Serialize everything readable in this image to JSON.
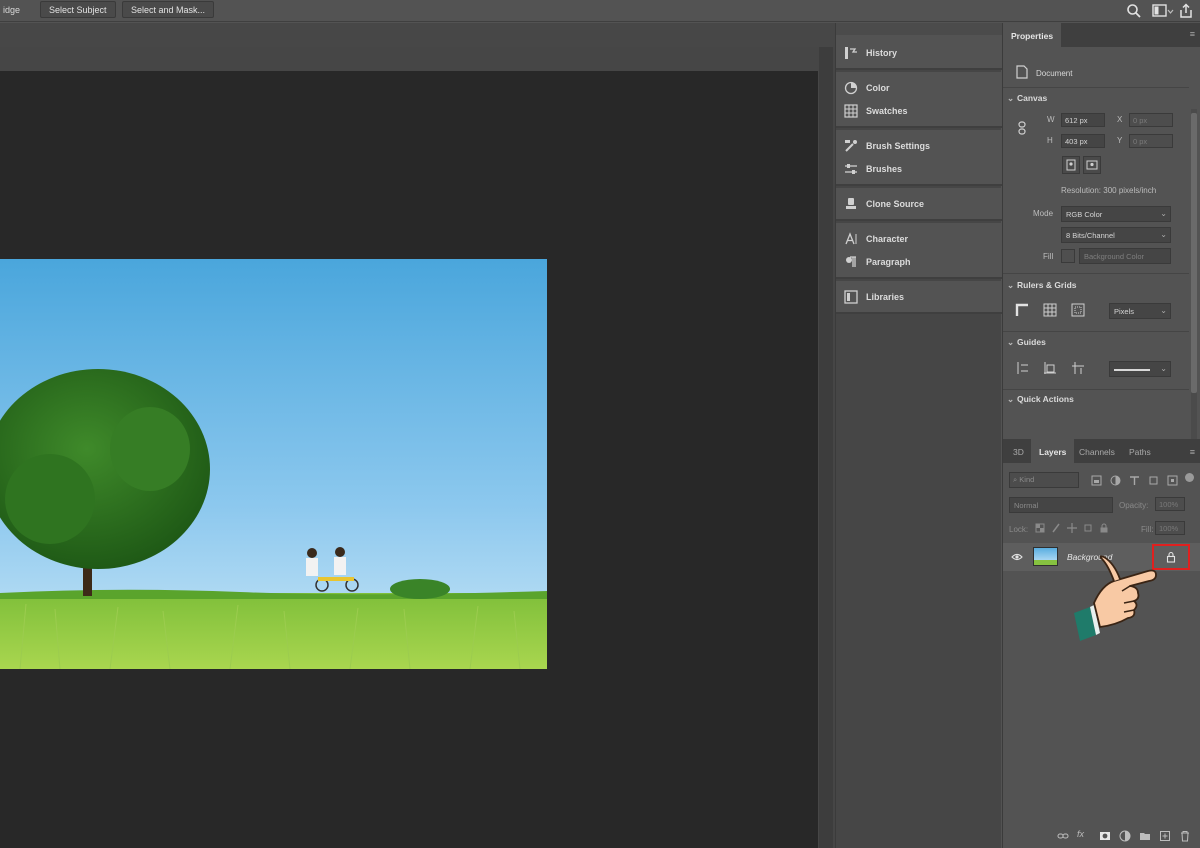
{
  "options_bar": {
    "edge_label": "idge",
    "select_subject": "Select Subject",
    "select_and_mask": "Select and Mask..."
  },
  "icons": {
    "search": "search-icon",
    "workspace": "workspace-icon",
    "share": "share-icon"
  },
  "panels": {
    "history": "History",
    "color": "Color",
    "swatches": "Swatches",
    "brush_settings": "Brush Settings",
    "brushes": "Brushes",
    "clone_source": "Clone Source",
    "character": "Character",
    "paragraph": "Paragraph",
    "libraries": "Libraries"
  },
  "properties": {
    "tab": "Properties",
    "kind": "Document",
    "canvas": {
      "header": "Canvas",
      "w_label": "W",
      "w_value": "612 px",
      "h_label": "H",
      "h_value": "403 px",
      "x_label": "X",
      "x_value": "0 px",
      "y_label": "Y",
      "y_value": "0 px",
      "resolution": "Resolution: 300 pixels/inch",
      "mode_label": "Mode",
      "mode_value": "RGB Color",
      "depth_value": "8 Bits/Channel",
      "fill_label": "Fill",
      "fill_value": "Background Color"
    },
    "rulers": {
      "header": "Rulers & Grids",
      "units": "Pixels"
    },
    "guides": {
      "header": "Guides"
    },
    "quick_actions": {
      "header": "Quick Actions"
    }
  },
  "layers": {
    "tabs": [
      "3D",
      "Layers",
      "Channels",
      "Paths"
    ],
    "active_tab": "Layers",
    "filter_placeholder": "Kind",
    "blend_mode": "Normal",
    "opacity_label": "Opacity:",
    "opacity_value": "100%",
    "lock_label": "Lock:",
    "fill_label": "Fill:",
    "fill_value": "100%",
    "layer_name": "Background",
    "layer_locked": true
  },
  "colors": {
    "highlight": "#e0201f",
    "canvas_bg": "#282828",
    "panel_bg": "#535353"
  }
}
